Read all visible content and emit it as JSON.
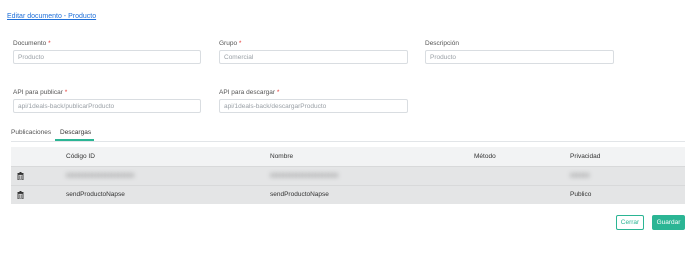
{
  "page": {
    "title": "Editar documento - Producto"
  },
  "form": {
    "documento": {
      "label": "Documento",
      "value": "Producto"
    },
    "grupo": {
      "label": "Grupo",
      "value": "Comercial"
    },
    "descripcion": {
      "label": "Descripción",
      "value": "Producto"
    },
    "api_publicar": {
      "label": "API para publicar",
      "value": "api/1deals-back/publicarProducto"
    },
    "api_descargar": {
      "label": "API para descargar",
      "value": "api/1deals-back/descargarProducto"
    },
    "required_mark": "*"
  },
  "tabs": [
    {
      "label": "Publicaciones",
      "active": false
    },
    {
      "label": "Descargas",
      "active": true
    }
  ],
  "table": {
    "headers": {
      "codigo": "Código ID",
      "nombre": "Nombre",
      "metodo": "Método",
      "privacidad": "Privacidad"
    },
    "rows": [
      {
        "codigo": "xxxxxxxxxxxxxxxxxxxxx",
        "nombre": "xxxxxxxxxxxxxxxxxxxxx",
        "metodo": "",
        "privacidad": "xxxxxx",
        "blurred": true
      },
      {
        "codigo": "sendProductoNapse",
        "nombre": "sendProductoNapse",
        "metodo": "",
        "privacidad": "Publico",
        "blurred": false
      }
    ]
  },
  "buttons": {
    "cancel": "Cerrar",
    "save": "Guardar"
  },
  "colors": {
    "accent": "#2bb594",
    "link": "#1e6fd9",
    "required": "#e53935"
  },
  "icons": {
    "row_action": "trash-icon"
  }
}
